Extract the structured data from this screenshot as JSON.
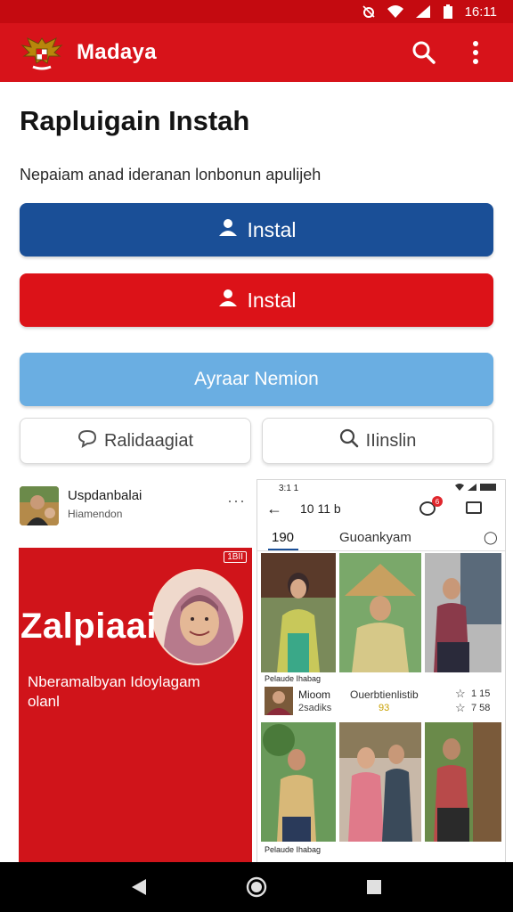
{
  "status_bar": {
    "time": "16:11",
    "icons": [
      "alarm-icon",
      "wifi-icon",
      "signal-icon",
      "battery-icon"
    ]
  },
  "app_bar": {
    "title": "Madaya",
    "logo": "garuda-emblem-icon",
    "actions": [
      "search-icon",
      "more-vert-icon"
    ]
  },
  "page": {
    "title": "Rapluigain Instah",
    "subtitle": "Nepaiam anad ideranan lonbonun apulijeh"
  },
  "buttons": {
    "primary_blue": {
      "label": "Instal",
      "icon": "person-icon"
    },
    "primary_red": {
      "label": "Instal",
      "icon": "person-icon"
    },
    "secondary": {
      "label": "Ayraar Nemion"
    },
    "outline_left": {
      "label": "Ralidaagiat",
      "icon": "chat-bubble-icon"
    },
    "outline_right": {
      "label": "IIinslin",
      "icon": "search-icon"
    }
  },
  "post": {
    "author": "Uspdanbalai",
    "meta": "Hiamendon",
    "more": "···"
  },
  "promo": {
    "badge": "1BII",
    "title": "Zalpiaai",
    "subtitle": "Nberamalbyan Idoylagam olanl"
  },
  "phone": {
    "status_time": "3:1 1",
    "toolbar_title": "10 11 b",
    "chat_badge": "6",
    "tab_count": "190",
    "tab_label": "Guoankyam",
    "feed": [
      {
        "caption": "Pelaude Ihabag",
        "name": "Mioom",
        "subname": "2sadiks",
        "mid": "Ouerbtienlistib",
        "mid2": "93",
        "count1": "1 15",
        "count2": "7 58"
      },
      {
        "caption": "Pelaude Ihabag",
        "name": "",
        "subname": "",
        "mid": "",
        "mid2": "",
        "count1": "",
        "count2": ""
      }
    ]
  },
  "nav_bar": {
    "buttons": [
      "back-icon",
      "home-icon",
      "recents-icon"
    ]
  },
  "colors": {
    "app_bar": "#d7131a",
    "blue_button": "#1a4f97",
    "red_button": "#dc1218",
    "light_button": "#6aaee2"
  }
}
